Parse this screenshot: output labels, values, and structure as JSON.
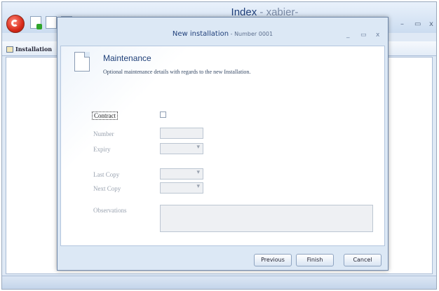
{
  "app": {
    "title": "Index",
    "title_suffix": " - xabier-",
    "ribbon_tab": "Installation",
    "window_controls": {
      "minimize": "–",
      "maximize": "▭",
      "close": "x"
    }
  },
  "dialog": {
    "title": "New installation",
    "subtitle": " - Number 0001",
    "controls": {
      "minimize": "_",
      "maximize": "▭",
      "close": "x"
    },
    "section_title": "Maintenance",
    "section_desc": "Optional maintenance details with regards to the new Installation.",
    "labels": {
      "contract": "Contract",
      "number": "Number",
      "expiry": "Expiry",
      "last_copy": "Last Copy",
      "next_copy": "Next Copy",
      "observations": "Observations"
    },
    "fields": {
      "contract_checked": false,
      "number": "",
      "expiry": "",
      "last_copy": "",
      "next_copy": "",
      "observations": ""
    },
    "buttons": {
      "previous": "Previous",
      "finish": "Finish",
      "cancel": "Cancel"
    }
  },
  "colors": {
    "accent": "#1e3f78",
    "dialog_bg": "#dce8f5",
    "disabled_label": "#9aa3b0"
  }
}
